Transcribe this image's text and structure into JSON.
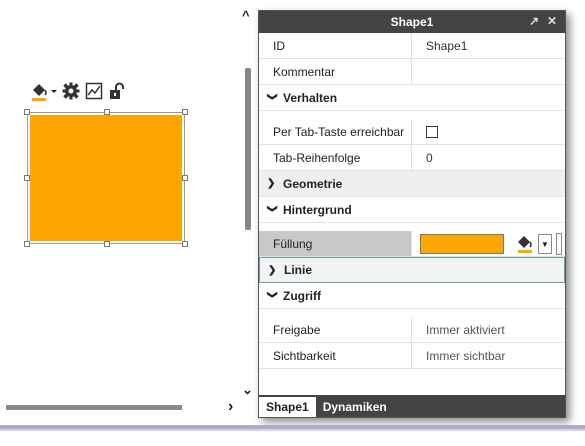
{
  "canvas": {
    "scroll_up": "^",
    "scroll_down": "⌄",
    "scroll_right": "›",
    "toolbar_icons": [
      "fill-bucket-icon",
      "gear-icon",
      "chart-icon",
      "unlock-icon"
    ],
    "shape_fill_color": "#ffa500"
  },
  "panel": {
    "title": "Shape1",
    "popout_label": "↗",
    "close_label": "✕",
    "rows": {
      "id_label": "ID",
      "id_value": "Shape1",
      "kommentar_label": "Kommentar",
      "kommentar_value": ""
    },
    "sections": {
      "verhalten": "Verhalten",
      "geometrie": "Geometrie",
      "hintergrund": "Hintergrund",
      "linie": "Linie",
      "zugriff": "Zugriff"
    },
    "verhalten": {
      "tab_label": "Per Tab-Taste erreichbar",
      "tab_checked": false,
      "order_label": "Tab-Reihenfolge",
      "order_value": "0"
    },
    "hintergrund": {
      "fill_label": "Füllung",
      "fill_color": "#ffa500"
    },
    "zugriff": {
      "freigabe_label": "Freigabe",
      "freigabe_value": "Immer aktiviert",
      "sicht_label": "Sichtbarkeit",
      "sicht_value": "Immer sichtbar"
    },
    "tabs": [
      "Shape1",
      "Dynamiken"
    ]
  }
}
